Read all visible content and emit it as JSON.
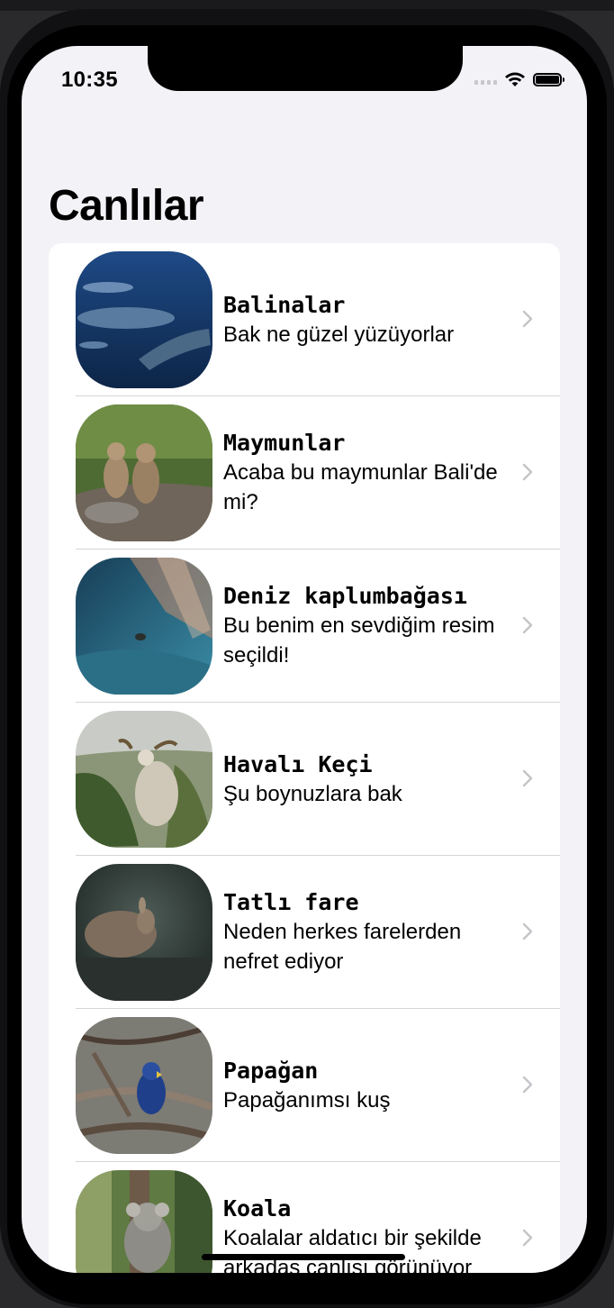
{
  "status_bar": {
    "time": "10:35"
  },
  "header": {
    "title": "Canlılar"
  },
  "items": [
    {
      "title": "Balinalar",
      "subtitle": "Bak ne güzel yüzüyorlar"
    },
    {
      "title": "Maymunlar",
      "subtitle": "Acaba bu maymunlar Bali'de mi?"
    },
    {
      "title": "Deniz kaplumbağası",
      "subtitle": "Bu benim en sevdiğim resim seçildi!"
    },
    {
      "title": "Havalı Keçi",
      "subtitle": "Şu boynuzlara bak"
    },
    {
      "title": "Tatlı fare",
      "subtitle": "Neden herkes farelerden nefret ediyor"
    },
    {
      "title": "Papağan",
      "subtitle": "Papağanımsı kuş"
    },
    {
      "title": "Koala",
      "subtitle": "Koalalar aldatıcı bir şekilde arkadaş canlısı görünüyor"
    }
  ],
  "icons": {
    "wifi": "wifi-icon",
    "battery": "battery-icon",
    "signal": "cellular-signal-icon",
    "chevron": "chevron-right-icon"
  }
}
